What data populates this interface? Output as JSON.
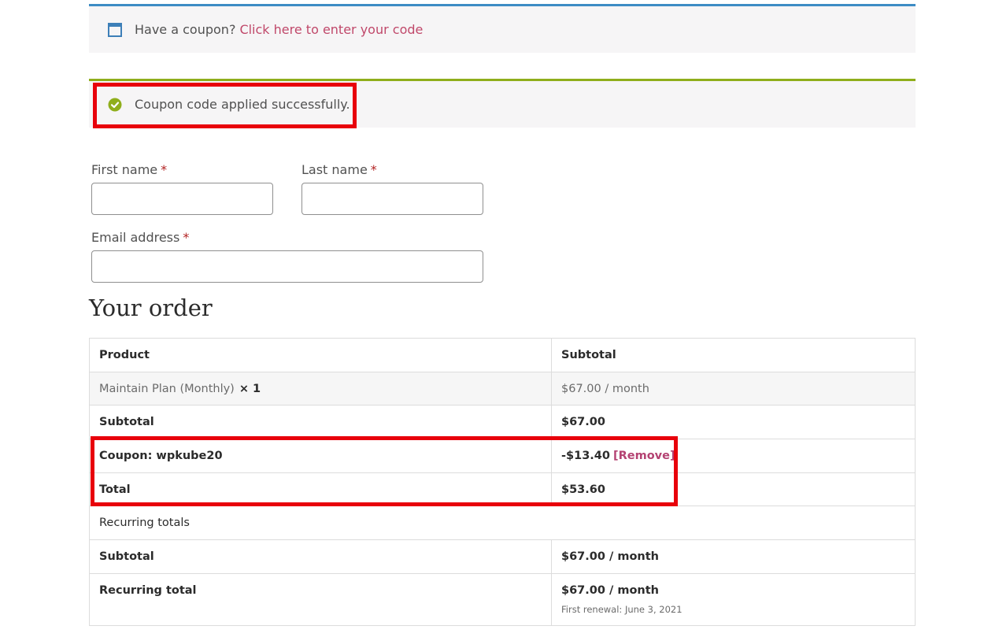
{
  "notices": {
    "coupon_prompt": "Have a coupon?",
    "coupon_link": "Click here to enter your code",
    "coupon_applied": "Coupon code applied successfully."
  },
  "form": {
    "first_name_label": "First name",
    "last_name_label": "Last name",
    "email_label": "Email address",
    "required_mark": "*",
    "first_name_value": "",
    "last_name_value": "",
    "email_value": ""
  },
  "order": {
    "heading": "Your order",
    "col_product": "Product",
    "col_subtotal": "Subtotal",
    "item_name": "Maintain Plan (Monthly)",
    "item_qty": "× 1",
    "item_price": "$67.00 / month",
    "subtotal_label": "Subtotal",
    "subtotal_value": "$67.00",
    "coupon_label": "Coupon: wpkube20",
    "coupon_value": "-$13.40",
    "coupon_remove": "[Remove]",
    "total_label": "Total",
    "total_value": "$53.60",
    "recurring_heading": "Recurring totals",
    "recurring_subtotal_label": "Subtotal",
    "recurring_subtotal_value": "$67.00 / month",
    "recurring_total_label": "Recurring total",
    "recurring_total_value": "$67.00 / month",
    "first_renewal": "First renewal: June 3, 2021"
  },
  "colors": {
    "info_accent": "#3d8cc4",
    "success_accent": "#8fae1b",
    "link": "#c0486a",
    "highlight": "#e8000b"
  },
  "icons": {
    "info": "window-icon",
    "success": "check-circle-icon"
  }
}
